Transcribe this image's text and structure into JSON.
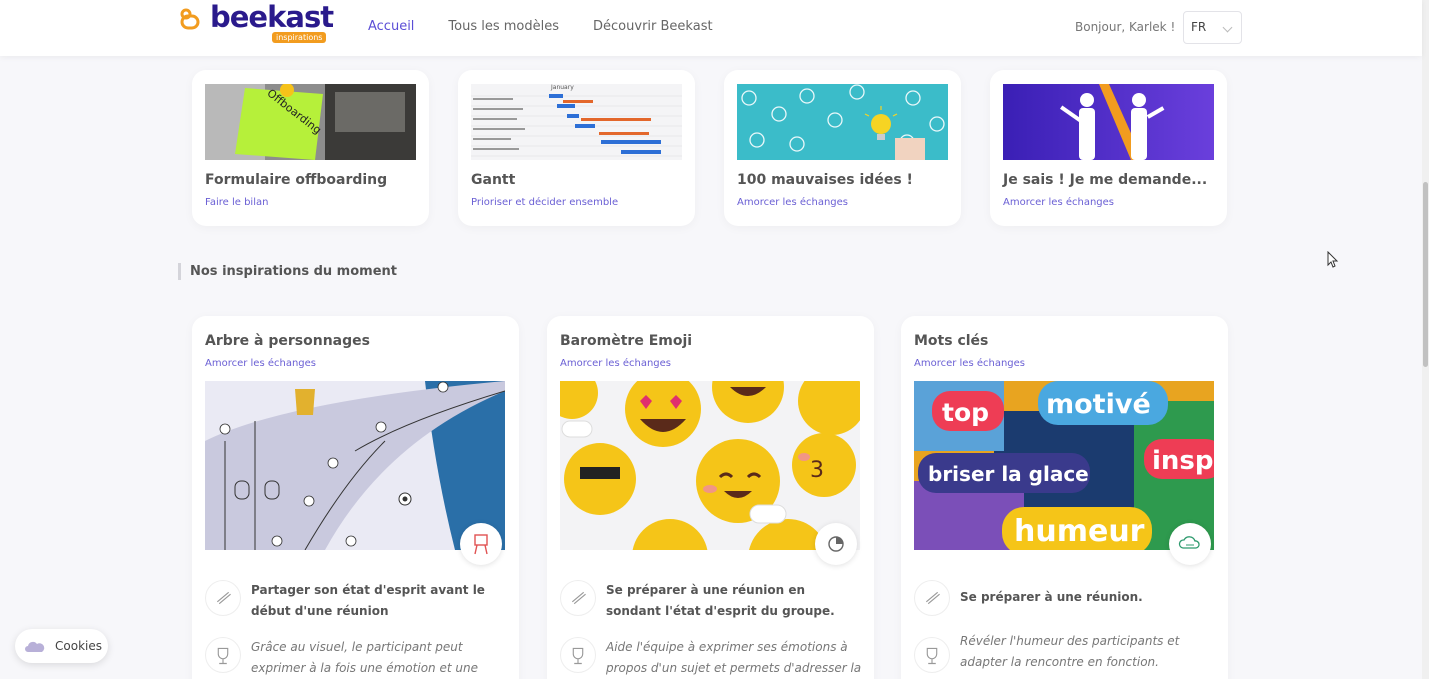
{
  "brand": {
    "name": "beekast",
    "tag": "inspirations",
    "color": "#2a1a8c",
    "accent": "#f29c1f"
  },
  "nav": {
    "items": [
      "Accueil",
      "Tous les modèles",
      "Découvrir Beekast"
    ],
    "active_index": 0,
    "active_color": "#5b4ed6"
  },
  "user": {
    "greeting": "Bonjour, Karlek !",
    "language": "FR"
  },
  "top_cards": [
    {
      "title": "Formulaire offboarding",
      "subtitle": "Faire le bilan",
      "image_text": "Offboarding"
    },
    {
      "title": "Gantt",
      "subtitle": "Prioriser et décider ensemble",
      "image_text": "January"
    },
    {
      "title": "100 mauvaises idées !",
      "subtitle": "Amorcer les échanges"
    },
    {
      "title": "Je sais ! Je me demande...",
      "subtitle": "Amorcer les échanges"
    }
  ],
  "section": {
    "title": "Nos inspirations du moment"
  },
  "inspirations": [
    {
      "title": "Arbre à personnages",
      "subtitle": "Amorcer les échanges",
      "badge_icon": "easel-icon",
      "goal": "Partager son état d'esprit avant le début d'une réunion",
      "benefit": "Grâce au visuel, le participant peut exprimer à la fois une émotion et une posture vis à vis du"
    },
    {
      "title": "Baromètre Emoji",
      "subtitle": "Amorcer les échanges",
      "badge_icon": "pie-chart-icon",
      "goal": "Se préparer à une réunion en sondant l'état d'esprit du groupe.",
      "benefit": "Aide l'équipe à exprimer ses émotions à propos d'un sujet et permets d'adresser la cause des"
    },
    {
      "title": "Mots clés",
      "subtitle": "Amorcer les échanges",
      "badge_icon": "word-cloud-icon",
      "goal": "Se préparer à une réunion.",
      "benefit": "Révéler l'humeur des participants et adapter la rencontre en fonction.",
      "image_words": [
        "top",
        "motivé",
        "insp",
        "briser la glace",
        "humeur"
      ]
    }
  ],
  "cookies": {
    "label": "Cookies"
  }
}
